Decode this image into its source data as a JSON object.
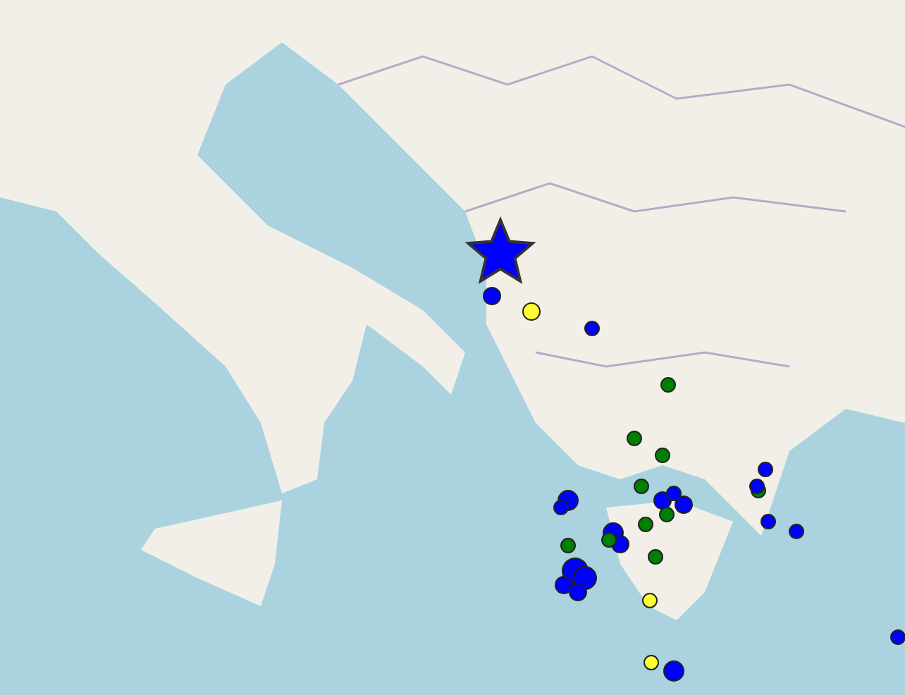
{
  "map": {
    "markers": [
      {
        "kind": "star",
        "color": "#0000ff"
      },
      {
        "kind": "circle",
        "color": "#0000ff"
      },
      {
        "kind": "circle",
        "color": "#ffff33"
      },
      {
        "kind": "circle",
        "color": "#0000ff"
      },
      {
        "kind": "circle",
        "color": "#008000"
      },
      {
        "kind": "circle",
        "color": "#008000"
      },
      {
        "kind": "circle",
        "color": "#008000"
      },
      {
        "kind": "circle",
        "color": "#0000ff"
      },
      {
        "kind": "circle",
        "color": "#0000ff"
      },
      {
        "kind": "circle",
        "color": "#008000"
      },
      {
        "kind": "circle",
        "color": "#0000ff"
      },
      {
        "kind": "circle",
        "color": "#0000ff"
      },
      {
        "kind": "circle",
        "color": "#0000ff"
      },
      {
        "kind": "circle",
        "color": "#008000"
      },
      {
        "kind": "circle",
        "color": "#008000"
      },
      {
        "kind": "circle",
        "color": "#0000ff"
      },
      {
        "kind": "circle",
        "color": "#0000ff"
      },
      {
        "kind": "circle",
        "color": "#008000"
      },
      {
        "kind": "circle",
        "color": "#008000"
      },
      {
        "kind": "circle",
        "color": "#0000ff"
      },
      {
        "kind": "circle",
        "color": "#0000ff"
      },
      {
        "kind": "circle",
        "color": "#0000ff"
      },
      {
        "kind": "circle",
        "color": "#0000ff"
      },
      {
        "kind": "circle",
        "color": "#008000"
      },
      {
        "kind": "circle",
        "color": "#0000ff"
      },
      {
        "kind": "circle",
        "color": "#008000"
      },
      {
        "kind": "circle",
        "color": "#0000ff"
      },
      {
        "kind": "circle",
        "color": "#0000ff"
      },
      {
        "kind": "circle",
        "color": "#0000ff"
      },
      {
        "kind": "circle",
        "color": "#ffff33"
      },
      {
        "kind": "circle",
        "color": "#ffff33"
      },
      {
        "kind": "circle",
        "color": "#0000ff"
      },
      {
        "kind": "circle",
        "color": "#0000ff"
      }
    ]
  }
}
